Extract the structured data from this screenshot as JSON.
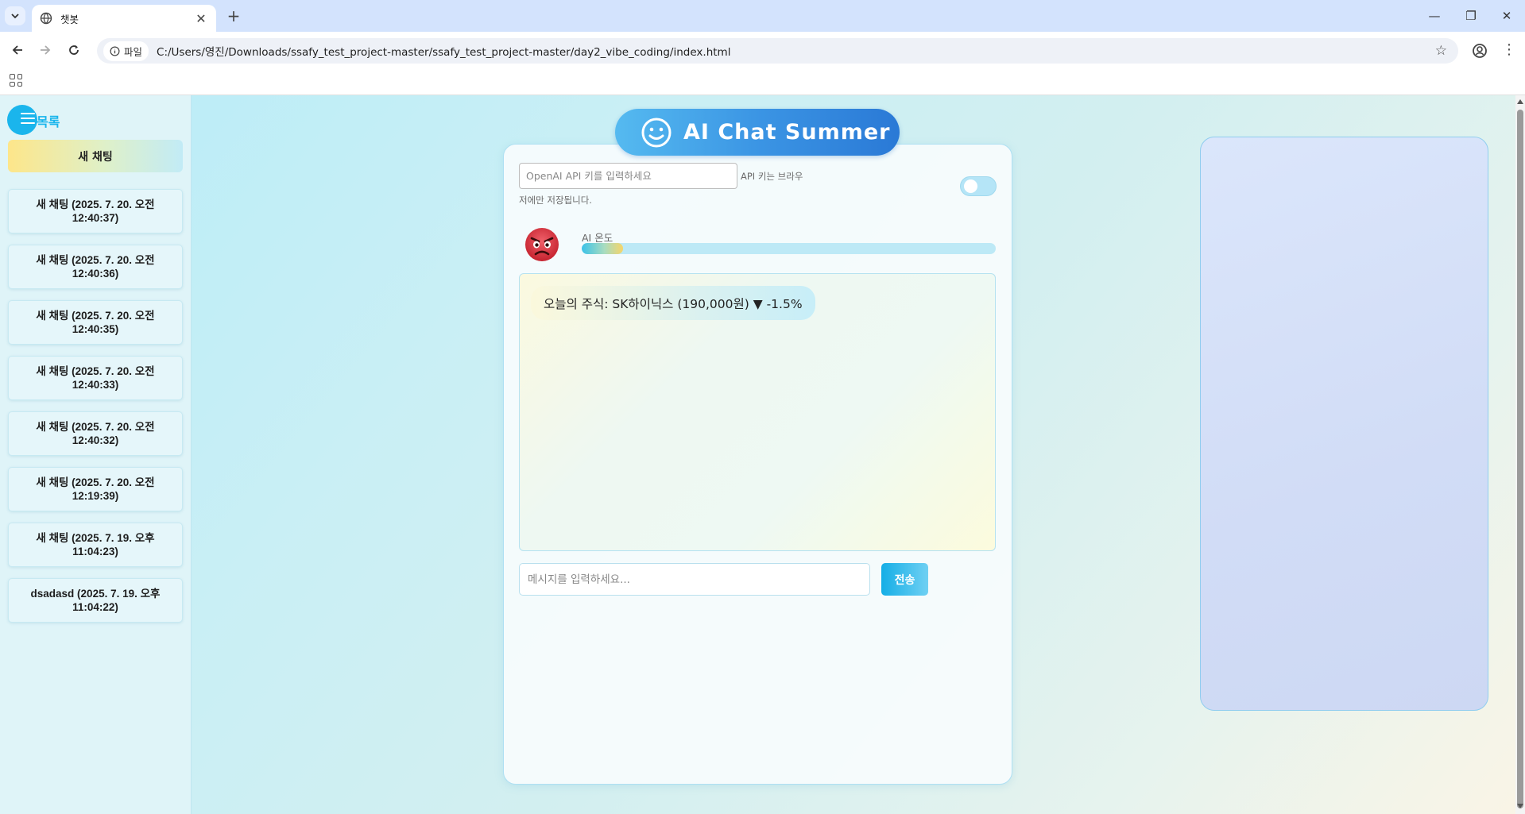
{
  "browser": {
    "tab_title": "챗봇",
    "site_chip": "파일",
    "url": "C:/Users/영진/Downloads/ssafy_test_project-master/ssafy_test_project-master/day2_vibe_coding/index.html"
  },
  "sidebar": {
    "title": "목록",
    "new_chat_label": "새 채팅",
    "items": [
      {
        "label": "새 채팅 (2025. 7. 20. 오전 12:40:37)"
      },
      {
        "label": "새 채팅 (2025. 7. 20. 오전 12:40:36)"
      },
      {
        "label": "새 채팅 (2025. 7. 20. 오전 12:40:35)"
      },
      {
        "label": "새 채팅 (2025. 7. 20. 오전 12:40:33)"
      },
      {
        "label": "새 채팅 (2025. 7. 20. 오전 12:40:32)"
      },
      {
        "label": "새 채팅 (2025. 7. 20. 오전 12:19:39)"
      },
      {
        "label": "새 채팅 (2025. 7. 19. 오후 11:04:23)"
      },
      {
        "label": "dsadasd (2025. 7. 19. 오후 11:04:22)"
      }
    ]
  },
  "header": {
    "title": "AI Chat Summer",
    "icon": "smiley-icon"
  },
  "api": {
    "placeholder": "OpenAI API 키를 입력하세요",
    "note_line1": "API 키는 브라우",
    "note_line2": "저에만 저장됩니다.",
    "toggle_on": false
  },
  "temperature": {
    "label": "AI 온도",
    "level": 0.1,
    "mood_icon": "angry-face-icon"
  },
  "chat": {
    "messages": [
      {
        "text": "오늘의 주식: SK하이닉스 (190,000원) ▼ -1.5%"
      }
    ]
  },
  "composer": {
    "placeholder": "메시지를 입력하세요...",
    "send_label": "전송"
  },
  "colors": {
    "accent": "#1ab5ec",
    "title_gradient_start": "#55baf0",
    "title_gradient_end": "#2a79d6"
  }
}
